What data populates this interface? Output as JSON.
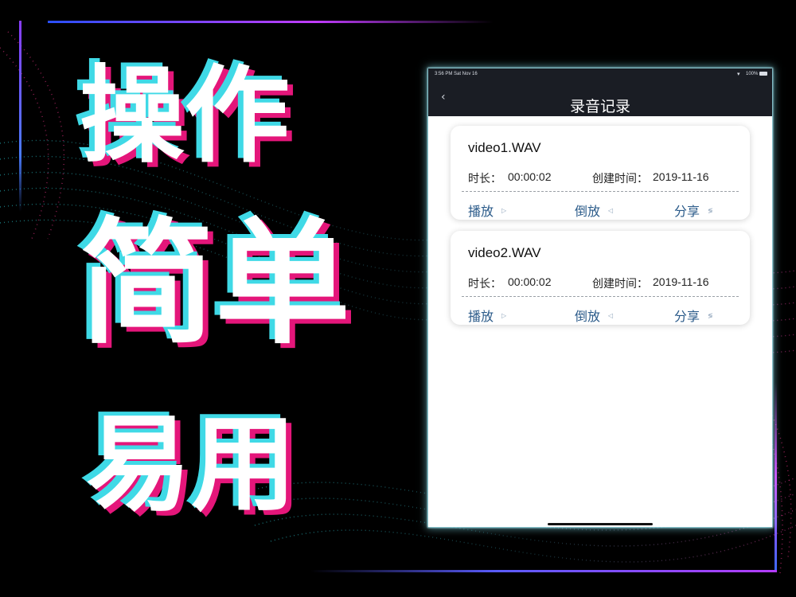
{
  "promo": {
    "line1": "操作",
    "line2": "简单",
    "line3": "易用"
  },
  "status_bar": {
    "time": "3:56 PM",
    "date": "Sat Nov 16",
    "battery": "100%"
  },
  "nav": {
    "back_glyph": "‹",
    "title": "录音记录"
  },
  "recordings": [
    {
      "name": "video1.WAV",
      "duration_label": "时长：",
      "duration": "00:00:02",
      "created_label": "创建时间：",
      "created": "2019-11-16",
      "actions": {
        "play": "播放",
        "reverse": "倒放",
        "share": "分享"
      }
    },
    {
      "name": "video2.WAV",
      "duration_label": "时长：",
      "duration": "00:00:02",
      "created_label": "创建时间：",
      "created": "2019-11-16",
      "actions": {
        "play": "播放",
        "reverse": "倒放",
        "share": "分享"
      }
    }
  ],
  "icons": {
    "play": "play-icon",
    "reverse": "reverse-play-icon",
    "share": "share-icon"
  },
  "colors": {
    "cyan_shadow": "#3fd9e6",
    "pink_shadow": "#e4167a",
    "action_text": "#2b5b8a",
    "nav_bg": "#1a1d24"
  }
}
